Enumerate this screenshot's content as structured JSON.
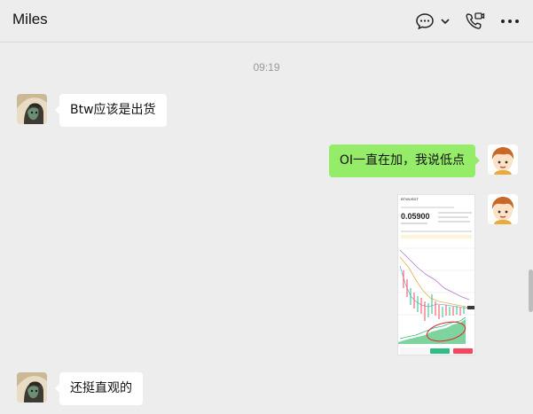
{
  "header": {
    "title": "Miles",
    "icons": [
      "chat-bubble-icon",
      "chevron-down-icon",
      "video-call-icon",
      "more-icon"
    ]
  },
  "conversation": {
    "timestamp": "09:19",
    "messages": [
      {
        "sender": "Miles",
        "side": "left",
        "text": "Btw应该是出货"
      },
      {
        "sender": "me",
        "side": "right",
        "text": "OI一直在加，我说低点"
      },
      {
        "sender": "me",
        "side": "right",
        "type": "image",
        "image": {
          "symbol": "BTWUSDT",
          "price": "0.05900",
          "buy_label": "",
          "sell_label": ""
        }
      },
      {
        "sender": "Miles",
        "side": "left",
        "text": "还挺直观的"
      }
    ]
  },
  "colors": {
    "background": "#ededed",
    "bubble_self": "#95ec69",
    "bubble_other": "#ffffff",
    "chart_buy": "#2ebd85",
    "chart_sell": "#f6465d",
    "annotation": "#e0242b"
  }
}
